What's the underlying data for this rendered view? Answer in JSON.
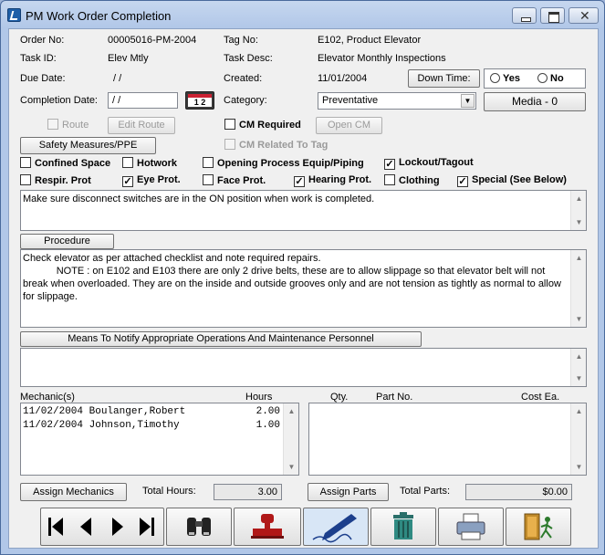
{
  "window": {
    "title": "PM Work Order Completion"
  },
  "fields": {
    "order_no_label": "Order No:",
    "order_no": "00005016-PM-2004",
    "tag_no_label": "Tag No:",
    "tag_no": "E102, Product Elevator",
    "task_id_label": "Task ID:",
    "task_id": "Elev Mtly",
    "task_desc_label": "Task Desc:",
    "task_desc": "Elevator Monthly Inspections",
    "due_date_label": "Due Date:",
    "due_date": "/  /",
    "created_label": "Created:",
    "created": "11/01/2004",
    "completion_date_label": "Completion Date:",
    "completion_date": " /  /",
    "category_label": "Category:",
    "category": "Preventative"
  },
  "buttons": {
    "down_time": "Down Time:",
    "yes": "Yes",
    "no": "No",
    "media": "Media - 0",
    "route": "Route",
    "edit_route": "Edit Route",
    "cm_required": "CM Required",
    "open_cm": "Open CM",
    "cm_related": "CM Related To Tag",
    "safety": "Safety Measures/PPE",
    "procedure": "Procedure",
    "notify": "Means To Notify Appropriate Operations And Maintenance Personnel",
    "assign_mechanics": "Assign Mechanics",
    "assign_parts": "Assign Parts",
    "calendar": "1 2"
  },
  "ppe": [
    {
      "label": "Confined Space",
      "checked": false
    },
    {
      "label": "Hotwork",
      "checked": false
    },
    {
      "label": "Opening Process Equip/Piping",
      "checked": false
    },
    {
      "label": "Lockout/Tagout",
      "checked": true
    },
    {
      "label": "Respir. Prot",
      "checked": false
    },
    {
      "label": "Eye Prot.",
      "checked": true
    },
    {
      "label": "Face Prot.",
      "checked": false
    },
    {
      "label": "Hearing Prot.",
      "checked": true
    },
    {
      "label": "Clothing",
      "checked": false
    },
    {
      "label": "Special (See Below)",
      "checked": true
    }
  ],
  "special_text": "Make sure disconnect switches are in the ON position when work is completed.",
  "procedure_text": [
    "Check elevator as per attached checklist and note required repairs.",
    "            NOTE : on E102 and E103 there are only 2 drive belts, these are to allow slippage so that elevator belt will not break when overloaded. They are on the inside and outside grooves only and are not tension as tightly as normal to allow for slippage."
  ],
  "notify_text": "",
  "mechanics": {
    "header_mech": "Mechanic(s)",
    "header_hours": "Hours",
    "rows": [
      {
        "entry": "11/02/2004 Boulanger,Robert",
        "hours": "2.00"
      },
      {
        "entry": "11/02/2004 Johnson,Timothy",
        "hours": "1.00"
      }
    ],
    "total_label": "Total Hours:",
    "total": "3.00"
  },
  "parts": {
    "header_qty": "Qty.",
    "header_part": "Part No.",
    "header_cost": "Cost Ea.",
    "total_label": "Total Parts:",
    "total": "$0.00"
  },
  "toolbar_icons": [
    "first-record-icon",
    "prev-record-icon",
    "next-record-icon",
    "last-record-icon",
    "binoculars-icon",
    "stamp-icon",
    "pen-sign-icon",
    "trash-icon",
    "printer-icon",
    "exit-door-icon"
  ]
}
